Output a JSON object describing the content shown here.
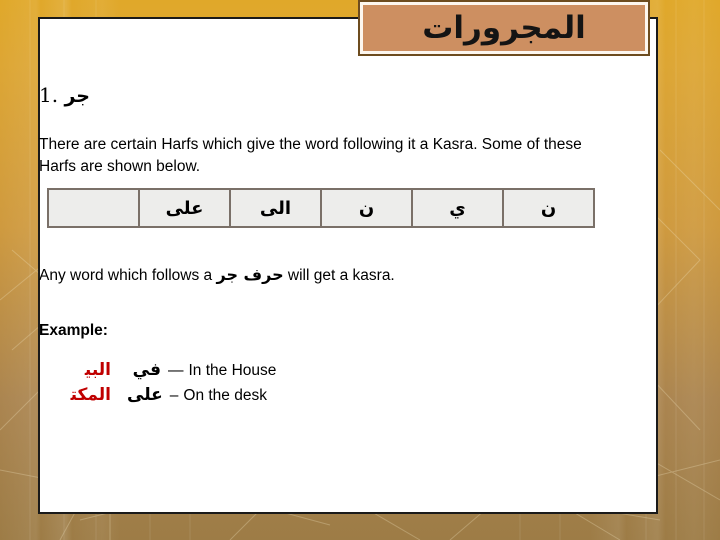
{
  "slide": {
    "title": "ﺍﻟﻤﺠﺮﻭﺭﺍﺕ",
    "heading_number": "1.",
    "heading_arabic": "ﺟﺮ",
    "intro_paragraph": "There are certain Harfs which give the word following it a Kasra. Some of these Harfs are shown below.",
    "rule_prefix": "Any word which follows a",
    "rule_arabic": "ﺣﺮﻑ ﺟﺮ",
    "rule_suffix": "will get a kasra.",
    "example_label": "Example:"
  },
  "harf_table": {
    "cells": [
      {
        "text": ""
      },
      {
        "text": "ﻋﻠﻰ"
      },
      {
        "text": "ﺍﻟﻰ"
      },
      {
        "text": "ﻥ"
      },
      {
        "text": "ﻱ"
      },
      {
        "text": "ﻥ"
      }
    ]
  },
  "examples": [
    {
      "word": "ﺍﻟﺒﻴ",
      "harf": "ﻓﻲ",
      "separator": "—",
      "gloss": "In the House"
    },
    {
      "word": "ﺍﻟﻤﻜﺘ",
      "harf": "ﻋﻠﻰ",
      "separator": "–",
      "gloss": "On the desk"
    }
  ],
  "colors": {
    "title_plate_fill": "#cd8f61",
    "title_plate_inner_border": "#fdf7ef",
    "title_plate_outer_border": "#6d4c1f",
    "card_background": "#ffffff",
    "card_border": "#1a1a1a",
    "table_cell_fill": "#ededeb",
    "table_cell_border": "#7a7068",
    "example_word_color": "#c00000",
    "background_gold_top": "#e0a82a",
    "background_tan_bottom": "#9d7c46"
  }
}
